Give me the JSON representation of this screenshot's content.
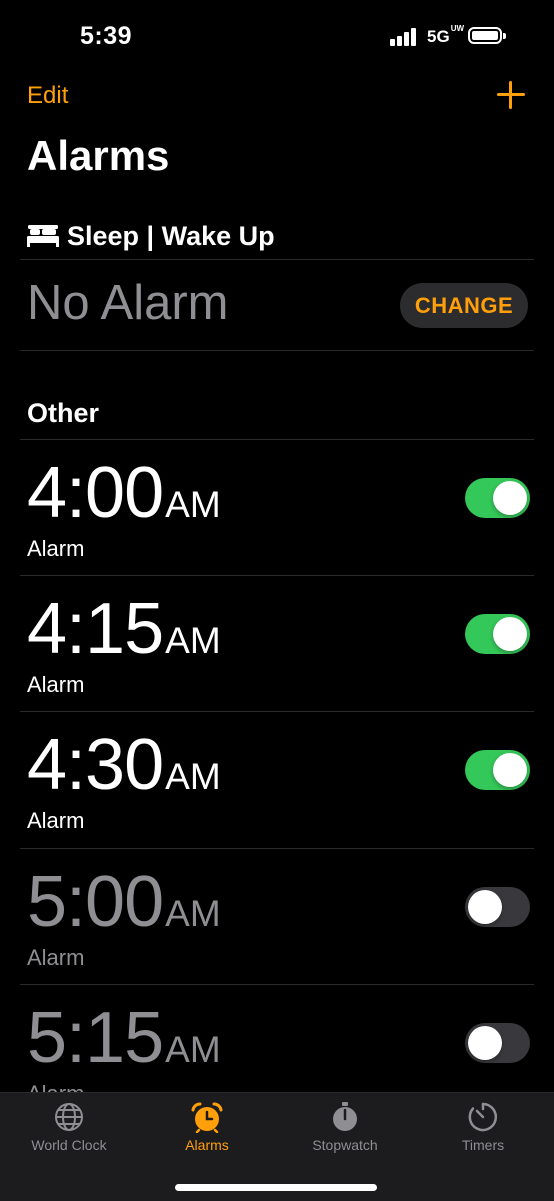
{
  "status_bar": {
    "time": "5:39",
    "network": "5G",
    "network_sup": "UW"
  },
  "nav": {
    "edit_label": "Edit",
    "add_icon": "plus-icon"
  },
  "title": "Alarms",
  "sleep": {
    "header": "Sleep | Wake Up",
    "value": "No Alarm",
    "change_label": "CHANGE"
  },
  "other_header": "Other",
  "alarms": [
    {
      "time": "4:00",
      "ampm": "AM",
      "label": "Alarm",
      "enabled": true
    },
    {
      "time": "4:15",
      "ampm": "AM",
      "label": "Alarm",
      "enabled": true
    },
    {
      "time": "4:30",
      "ampm": "AM",
      "label": "Alarm",
      "enabled": true
    },
    {
      "time": "5:00",
      "ampm": "AM",
      "label": "Alarm",
      "enabled": false
    },
    {
      "time": "5:15",
      "ampm": "AM",
      "label": "Alarm",
      "enabled": false
    }
  ],
  "tabs": [
    {
      "label": "World Clock",
      "icon": "globe-icon",
      "active": false
    },
    {
      "label": "Alarms",
      "icon": "alarm-clock-icon",
      "active": true
    },
    {
      "label": "Stopwatch",
      "icon": "stopwatch-icon",
      "active": false
    },
    {
      "label": "Timers",
      "icon": "timer-icon",
      "active": false
    }
  ],
  "colors": {
    "accent": "#ff9f0a",
    "toggle_on": "#34c759",
    "dim_text": "#8e8e93"
  }
}
